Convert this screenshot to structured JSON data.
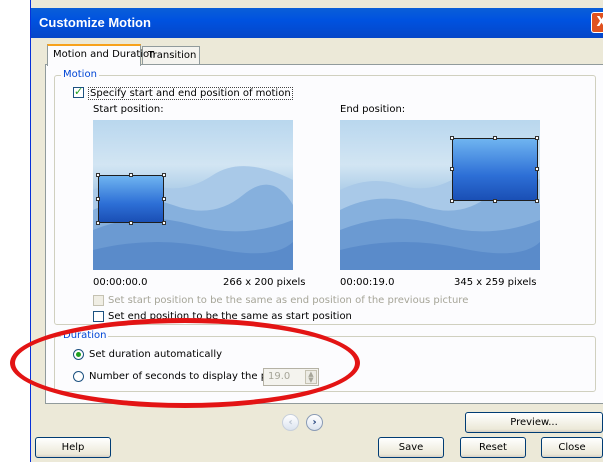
{
  "window": {
    "title": "Customize Motion",
    "close_glyph": "X"
  },
  "tabs": [
    {
      "label": "Motion and Duration",
      "active": true
    },
    {
      "label": "Transition",
      "active": false
    }
  ],
  "motion": {
    "group_label": "Motion",
    "specify_checkbox": {
      "label": "Specify start and end position of motion",
      "checked": true
    },
    "start": {
      "label": "Start position:",
      "time": "00:00:00.0",
      "size": "266 x 200 pixels"
    },
    "end": {
      "label": "End position:",
      "time": "00:00:19.0",
      "size": "345 x 259 pixels"
    },
    "same_as_prev_checkbox": {
      "label": "Set start position to be the same as end position of the previous picture",
      "checked": false,
      "enabled": false
    },
    "same_as_start_checkbox": {
      "label": "Set end position to be the same as start position",
      "checked": false,
      "enabled": true
    }
  },
  "duration": {
    "group_label": "Duration",
    "auto_radio": {
      "label": "Set duration automatically",
      "selected": true
    },
    "seconds_radio": {
      "label": "Number of seconds to display the picture",
      "selected": false
    },
    "seconds_value": "19.0"
  },
  "navigation": {
    "prev_glyph": "‹",
    "next_glyph": "›"
  },
  "buttons": {
    "preview": "Preview...",
    "help": "Help",
    "save": "Save",
    "reset": "Reset",
    "close": "Close"
  },
  "colors": {
    "title_bar": "#0a5fd8",
    "annotation": "#e31414",
    "group_label": "#0046d5"
  }
}
